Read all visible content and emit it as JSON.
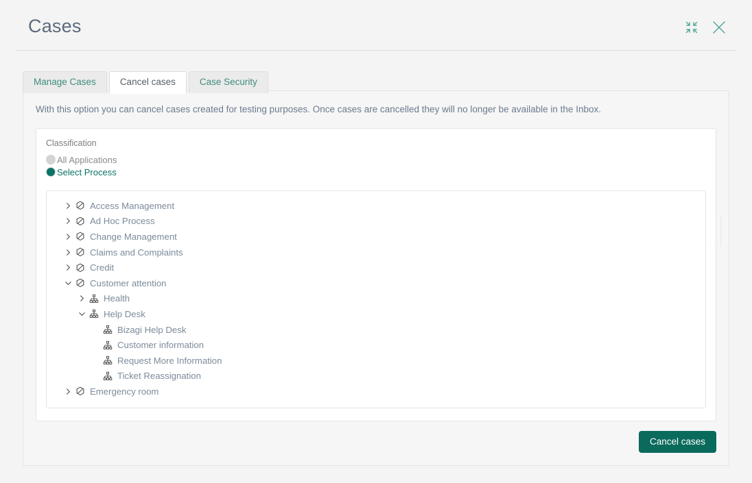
{
  "header": {
    "title": "Cases",
    "actions": [
      {
        "name": "collapse-icon",
        "label": "Collapse"
      },
      {
        "name": "close-icon",
        "label": "Close"
      }
    ],
    "accent_color": "#3f8c7c"
  },
  "tabs": [
    {
      "label": "Manage Cases",
      "active": false
    },
    {
      "label": "Cancel cases",
      "active": true
    },
    {
      "label": "Case Security",
      "active": false
    }
  ],
  "main": {
    "description": "With this option you can cancel cases created for testing purposes. Once cases are cancelled they will no longer be available in the Inbox.",
    "classification": {
      "label": "Classification",
      "options": [
        {
          "label": "All Applications",
          "selected": false
        },
        {
          "label": "Select Process",
          "selected": true
        }
      ]
    },
    "tree": [
      {
        "label": "Access Management",
        "level": 0,
        "icon": "hexagon-application-icon",
        "state": "collapsed"
      },
      {
        "label": "Ad Hoc Process",
        "level": 0,
        "icon": "hexagon-application-icon",
        "state": "collapsed"
      },
      {
        "label": "Change Management",
        "level": 0,
        "icon": "hexagon-application-icon",
        "state": "collapsed"
      },
      {
        "label": "Claims and Complaints",
        "level": 0,
        "icon": "hexagon-application-icon",
        "state": "collapsed"
      },
      {
        "label": "Credit",
        "level": 0,
        "icon": "hexagon-application-icon",
        "state": "collapsed"
      },
      {
        "label": "Customer attention",
        "level": 0,
        "icon": "hexagon-application-icon",
        "state": "expanded"
      },
      {
        "label": "Health",
        "level": 1,
        "icon": "sitemap-process-icon",
        "state": "collapsed"
      },
      {
        "label": "Help Desk",
        "level": 1,
        "icon": "sitemap-process-icon",
        "state": "expanded"
      },
      {
        "label": "Bizagi Help Desk",
        "level": 2,
        "icon": "sitemap-process-icon",
        "state": "leaf"
      },
      {
        "label": "Customer information",
        "level": 2,
        "icon": "sitemap-process-icon",
        "state": "leaf"
      },
      {
        "label": "Request More Information",
        "level": 2,
        "icon": "sitemap-process-icon",
        "state": "leaf"
      },
      {
        "label": "Ticket Reassignation",
        "level": 2,
        "icon": "sitemap-process-icon",
        "state": "leaf"
      },
      {
        "label": "Emergency room",
        "level": 0,
        "icon": "hexagon-application-icon",
        "state": "collapsed"
      }
    ],
    "submit_button": {
      "label": "Cancel cases",
      "color": "#0a6b5c"
    }
  }
}
